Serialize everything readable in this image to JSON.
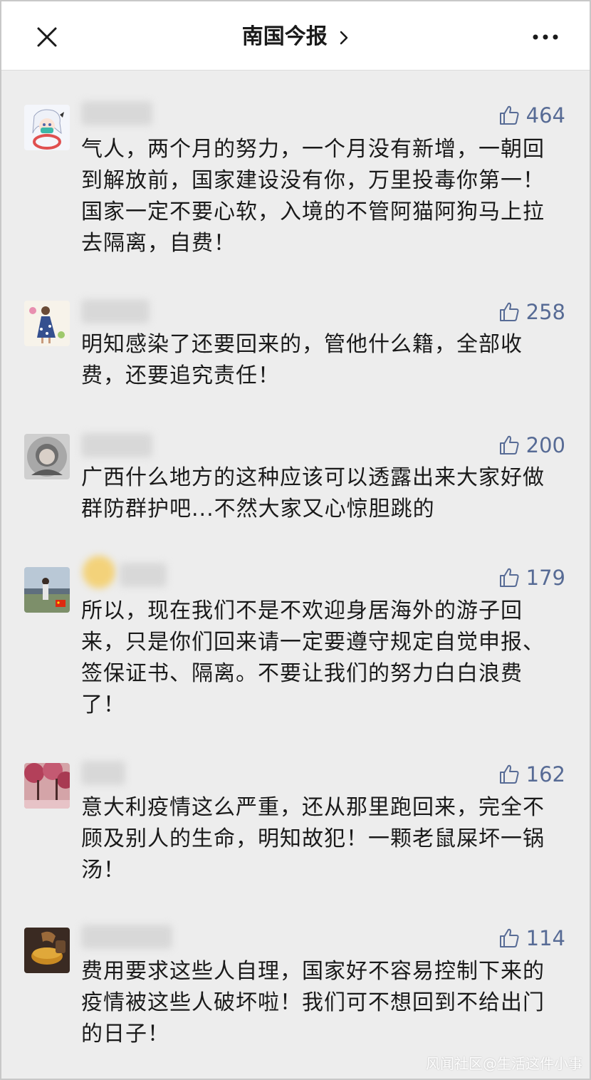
{
  "header": {
    "title": "南国今报",
    "close_icon": "close-icon",
    "more_icon": "more-horizontal-icon"
  },
  "comments": [
    {
      "likes": "464",
      "text": "气人，两个月的努力，一个月没有新增，一朝回到解放前，国家建设没有你，万里投毒你第一！国家一定不要心软，入境的不管阿猫阿狗马上拉去隔离，自费！"
    },
    {
      "likes": "258",
      "text": "明知感染了还要回来的，管他什么籍，全部收费，还要追究责任！"
    },
    {
      "likes": "200",
      "text": "广西什么地方的这种应该可以透露出来大家好做群防群护吧...不然大家又心惊胆跳的"
    },
    {
      "likes": "179",
      "text": "所以，现在我们不是不欢迎身居海外的游子回来，只是你们回来请一定要遵守规定自觉申报、签保证书、隔离。不要让我们的努力白白浪费了！"
    },
    {
      "likes": "162",
      "text": "意大利疫情这么严重，还从那里跑回来，完全不顾及别人的生命，明知故犯！一颗老鼠屎坏一锅汤！"
    },
    {
      "likes": "114",
      "text": "费用要求这些人自理，国家好不容易控制下来的疫情被这些人破坏啦！我们可不想回到不给出门的日子！"
    }
  ],
  "watermark": "风闻社区@生活这件小事",
  "colors": {
    "accent": "#576b95",
    "background": "#ededed",
    "text": "#1a1a1a"
  }
}
